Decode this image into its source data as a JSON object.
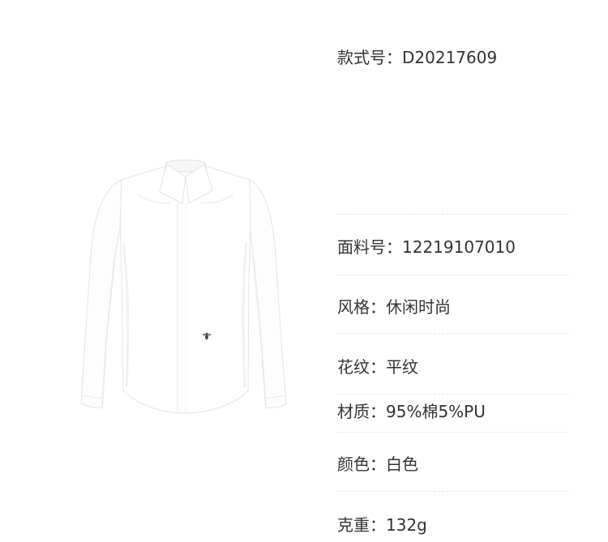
{
  "colors": {
    "text": "#333333",
    "divider": "#e6e6e6",
    "background": "#ffffff",
    "shirt": "#ffffff"
  },
  "specs": [
    {
      "label": "款式号：",
      "value": "D20217609"
    },
    {
      "label": "面料号：",
      "value": "12219107010"
    },
    {
      "label": "风格：",
      "value": "休闲时尚"
    },
    {
      "label": "花纹：",
      "value": "平纹"
    },
    {
      "label": "材质：",
      "value": "95%棉5%PU"
    },
    {
      "label": "颜色：",
      "value": "白色"
    },
    {
      "label": "克重：",
      "value": "132g"
    }
  ]
}
